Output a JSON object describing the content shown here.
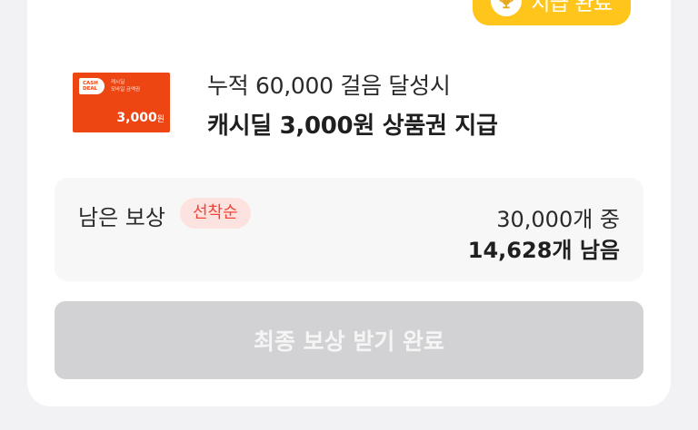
{
  "badge": {
    "icon": "trophy-icon",
    "label": "지급 완료",
    "color": "#ffc51a"
  },
  "voucher": {
    "logo_text_line1": "CASH",
    "logo_text_line2": "DEAL",
    "small_line1": "캐시딜",
    "small_line2": "모바일 금액권",
    "amount": "3,000",
    "amount_unit": "원",
    "color": "#ee4613"
  },
  "mission": {
    "condition": "누적 60,000 걸음 달성시",
    "reward": "캐시딜 3,000원 상품권 지급"
  },
  "remaining": {
    "label": "남은 보상",
    "tag": "선착순",
    "total": "30,000개 중",
    "left": "14,628개 남음"
  },
  "final_button": {
    "label": "최종 보상 받기 완료",
    "status": "disabled"
  }
}
